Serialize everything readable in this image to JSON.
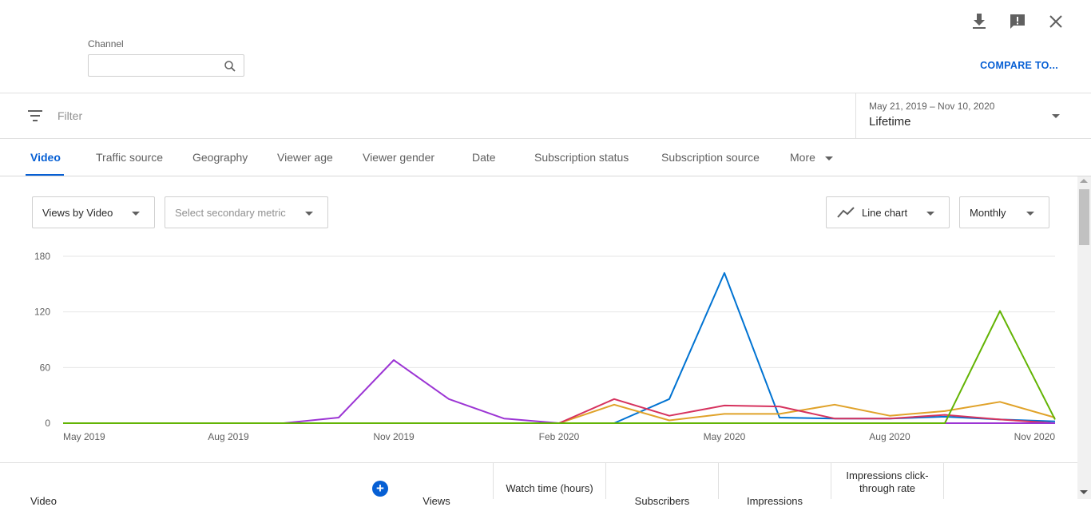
{
  "header": {
    "channel_label": "Channel",
    "channel_value": "",
    "compare_label": "COMPARE TO...",
    "icons": [
      "download-icon",
      "feedback-icon",
      "close-icon"
    ]
  },
  "filter": {
    "placeholder": "Filter",
    "date_range": "May 21, 2019 – Nov 10, 2020",
    "date_preset": "Lifetime"
  },
  "tabs": [
    {
      "label": "Video",
      "active": true
    },
    {
      "label": "Traffic source",
      "active": false
    },
    {
      "label": "Geography",
      "active": false
    },
    {
      "label": "Viewer age",
      "active": false
    },
    {
      "label": "Viewer gender",
      "active": false
    },
    {
      "label": "Date",
      "active": false
    },
    {
      "label": "Subscription status",
      "active": false
    },
    {
      "label": "Subscription source",
      "active": false
    },
    {
      "label": "More",
      "active": false
    }
  ],
  "controls": {
    "primary_metric": "Views by Video",
    "secondary_metric": "Select secondary metric",
    "chart_type": "Line chart",
    "interval": "Monthly"
  },
  "colors": {
    "accent": "#065fd4",
    "series": [
      "#0073d2",
      "#e0a229",
      "#d6325e",
      "#9c35d4",
      "#63b404"
    ]
  },
  "chart_data": {
    "type": "line",
    "title": "",
    "xlabel": "",
    "ylabel": "",
    "x": [
      "May 2019",
      "Jun 2019",
      "Jul 2019",
      "Aug 2019",
      "Sep 2019",
      "Oct 2019",
      "Nov 2019",
      "Dec 2019",
      "Jan 2020",
      "Feb 2020",
      "Mar 2020",
      "Apr 2020",
      "May 2020",
      "Jun 2020",
      "Jul 2020",
      "Aug 2020",
      "Sep 2020",
      "Oct 2020",
      "Nov 2020"
    ],
    "x_tick_labels": [
      "May 2019",
      "Aug 2019",
      "Nov 2019",
      "Feb 2020",
      "May 2020",
      "Aug 2020",
      "Nov 2020"
    ],
    "x_tick_index": [
      0,
      3,
      6,
      9,
      12,
      15,
      18
    ],
    "y_ticks": [
      0,
      60,
      120,
      180
    ],
    "ylim": [
      0,
      180
    ],
    "grid": true,
    "series": [
      {
        "color": "#0073d2",
        "values": [
          0,
          0,
          0,
          0,
          0,
          0,
          0,
          0,
          0,
          0,
          0,
          26,
          162,
          6,
          5,
          5,
          7,
          4,
          2
        ]
      },
      {
        "color": "#e0a229",
        "values": [
          0,
          0,
          0,
          0,
          0,
          0,
          0,
          0,
          0,
          0,
          20,
          3,
          10,
          10,
          20,
          8,
          13,
          23,
          6
        ]
      },
      {
        "color": "#d6325e",
        "values": [
          0,
          0,
          0,
          0,
          0,
          0,
          0,
          0,
          0,
          0,
          26,
          8,
          19,
          18,
          5,
          5,
          9,
          4,
          0
        ]
      },
      {
        "color": "#9c35d4",
        "values": [
          0,
          0,
          0,
          0,
          0,
          6,
          68,
          26,
          5,
          0,
          0,
          0,
          0,
          0,
          0,
          0,
          0,
          0,
          0
        ]
      },
      {
        "color": "#63b404",
        "values": [
          0,
          0,
          0,
          0,
          0,
          0,
          0,
          0,
          0,
          0,
          0,
          0,
          0,
          0,
          0,
          0,
          0,
          121,
          4
        ]
      }
    ]
  },
  "table": {
    "headers": [
      "Video",
      "Views",
      "Watch time (hours)",
      "Subscribers",
      "Impressions",
      "Impressions click-through rate"
    ]
  }
}
